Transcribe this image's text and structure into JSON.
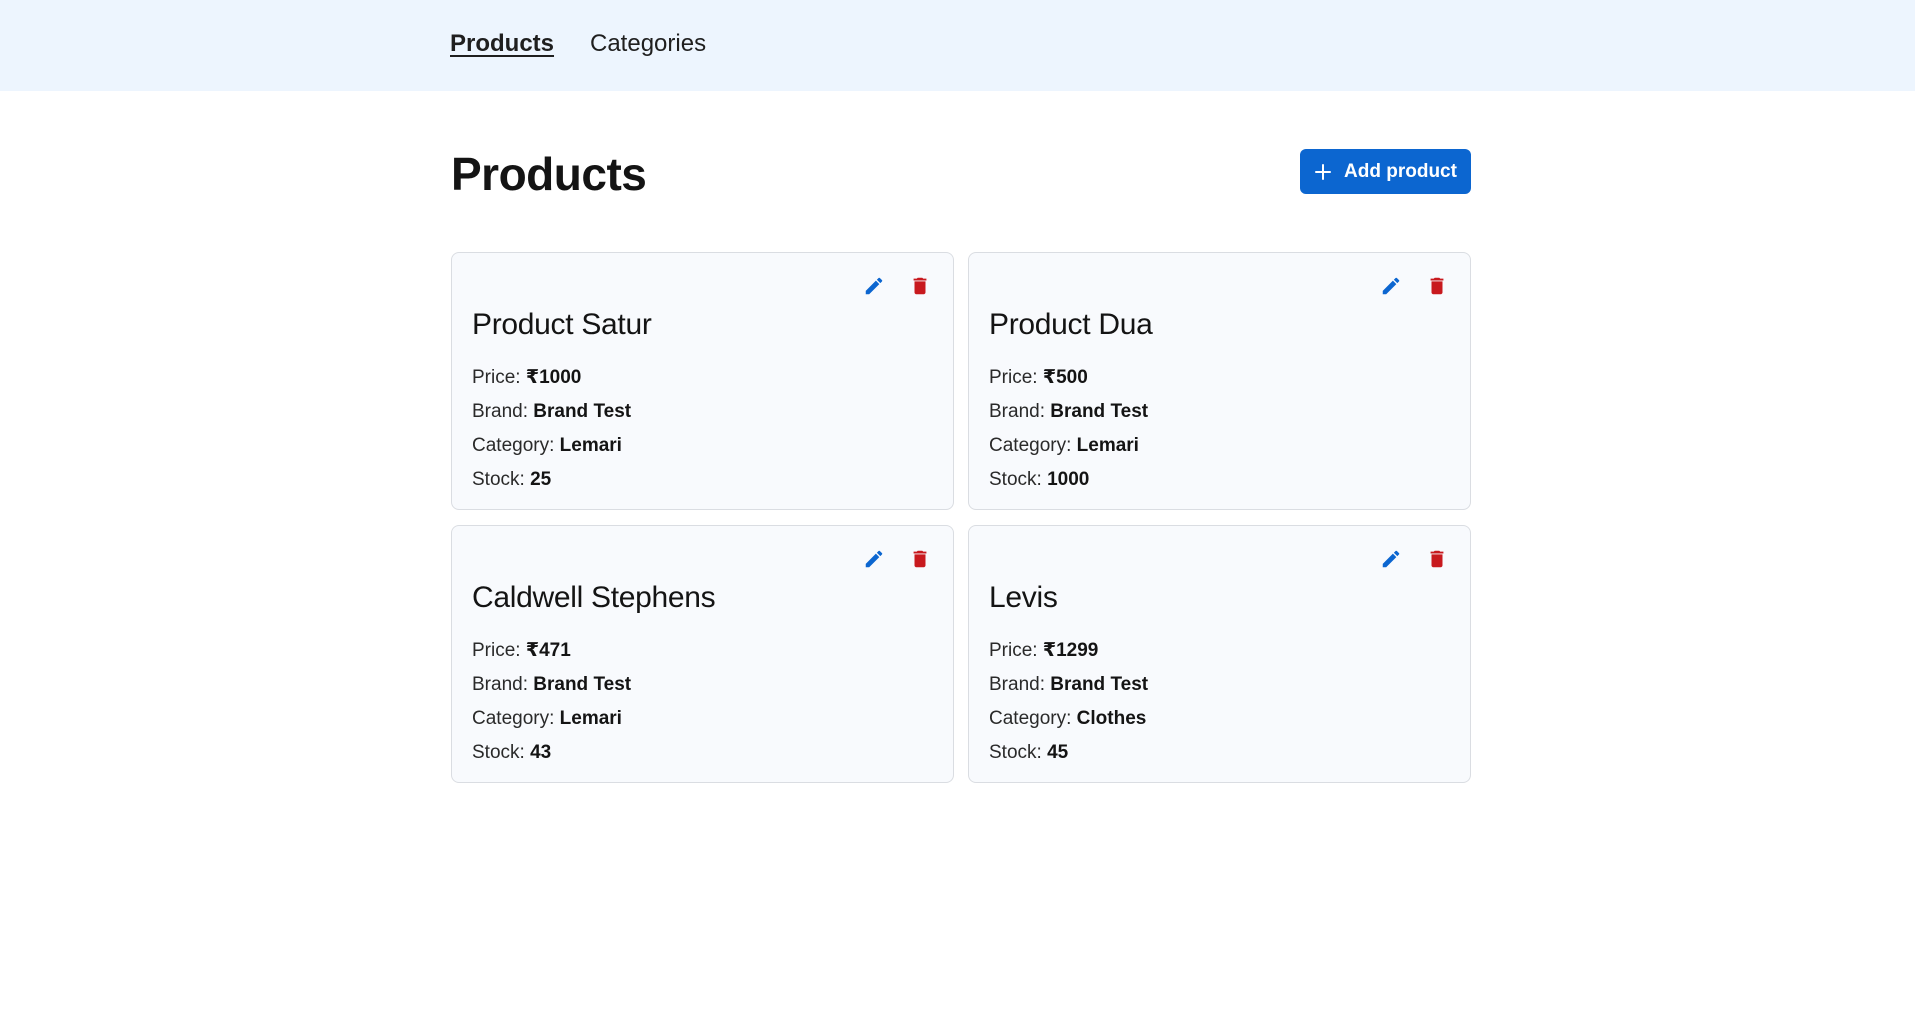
{
  "nav": {
    "items": [
      {
        "label": "Products",
        "active": true
      },
      {
        "label": "Categories",
        "active": false
      }
    ]
  },
  "page": {
    "title": "Products",
    "add_button_label": "Add product"
  },
  "labels": {
    "price": "Price: ",
    "brand": "Brand: ",
    "category": "Category: ",
    "stock": "Stock: "
  },
  "products": [
    {
      "name": "Product Satur",
      "price": "₹1000",
      "brand": "Brand Test",
      "category": "Lemari",
      "stock": "25"
    },
    {
      "name": "Product Dua",
      "price": "₹500",
      "brand": "Brand Test",
      "category": "Lemari",
      "stock": "1000"
    },
    {
      "name": "Caldwell Stephens",
      "price": "₹471",
      "brand": "Brand Test",
      "category": "Lemari",
      "stock": "43"
    },
    {
      "name": "Levis",
      "price": "₹1299",
      "brand": "Brand Test",
      "category": "Clothes",
      "stock": "45"
    }
  ],
  "icons": {
    "edit": "pencil-icon",
    "delete": "trash-icon"
  },
  "colors": {
    "nav_bg": "#edf5fe",
    "primary": "#0c66d0",
    "danger": "#c8191e",
    "card_bg": "#f8fafd"
  }
}
